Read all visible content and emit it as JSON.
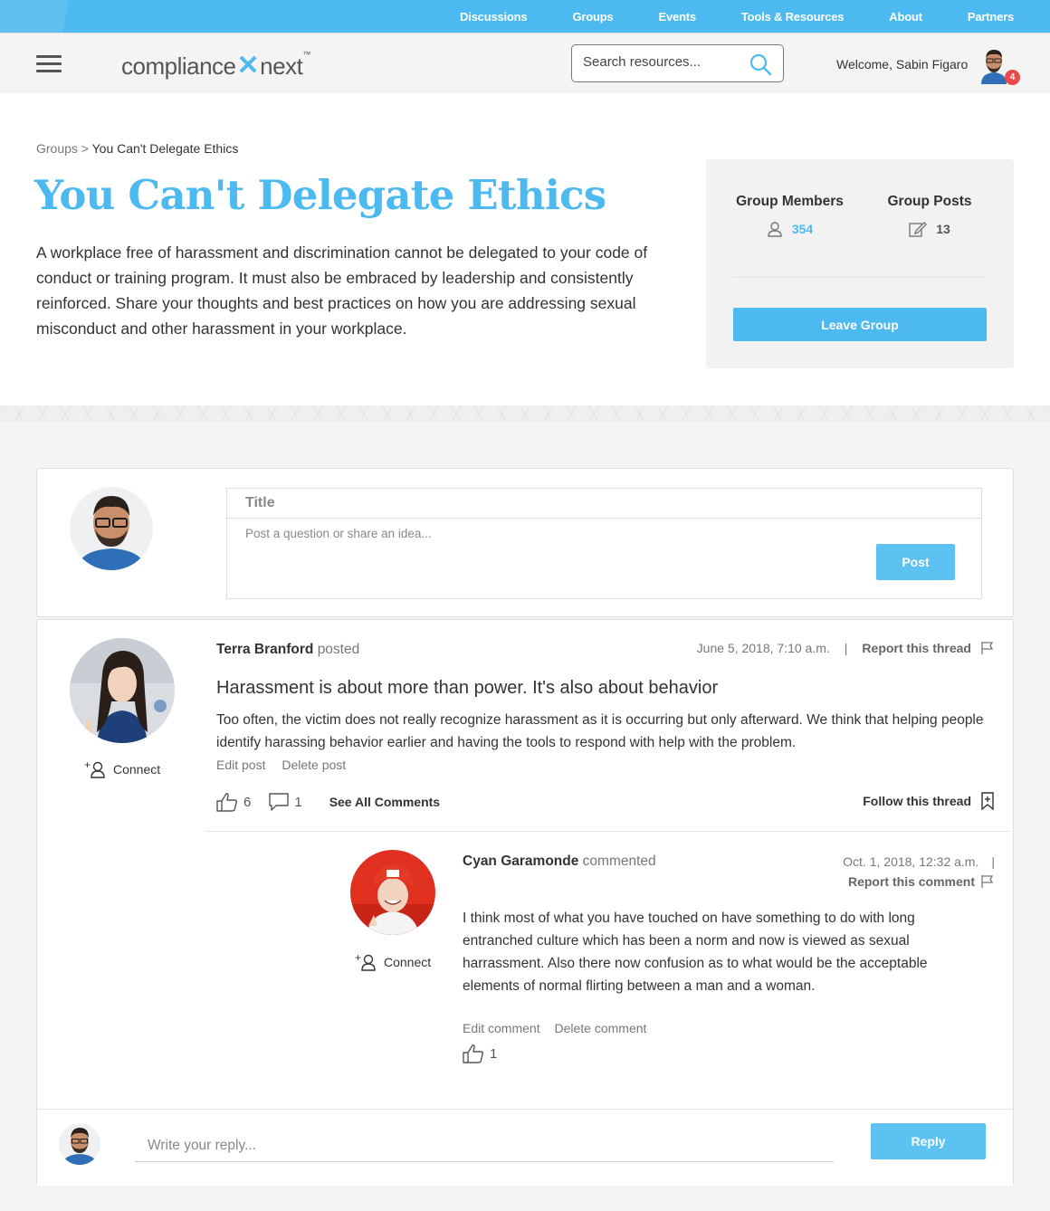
{
  "topnav": {
    "items": [
      "Discussions",
      "Groups",
      "Events",
      "Tools & Resources",
      "About",
      "Partners"
    ]
  },
  "header": {
    "logo_left": "compliance",
    "logo_x": "✕",
    "logo_right": "next",
    "logo_tm": "™",
    "search_placeholder": "Search resources...",
    "welcome": "Welcome, Sabin Figaro",
    "notification_count": "4"
  },
  "hero": {
    "breadcrumb_root": "Groups",
    "breadcrumb_sep": " > ",
    "breadcrumb_current": "You Can't Delegate Ethics",
    "title": "You Can't Delegate Ethics",
    "description": "A workplace free of harassment and discrimination cannot be delegated to your code of conduct or training program. It must also be embraced by leadership and consistently reinforced. Share your thoughts and best practices on how you are addressing sexual misconduct and other harassment in your workplace."
  },
  "group_card": {
    "members_label": "Group Members",
    "members_count": "354",
    "posts_label": "Group Posts",
    "posts_count": "13",
    "leave_label": "Leave Group"
  },
  "composer": {
    "title_placeholder": "Title",
    "body_placeholder": "Post a question or share an idea...",
    "post_label": "Post"
  },
  "thread": {
    "author": "Terra Branford",
    "action": "posted",
    "date": "June 5, 2018, 7:10 a.m.",
    "separator": "|",
    "report_label": "Report this thread",
    "title": "Harassment is about more than power. It's also about behavior",
    "body": "Too often, the victim does not really recognize harassment as it is occurring but only afterward. We think that helping people identify harassing behavior earlier and having the tools to respond with help with the problem.",
    "edit_label": "Edit post",
    "delete_label": "Delete post",
    "likes": "6",
    "comments": "1",
    "see_all_label": "See All Comments",
    "follow_label": "Follow this thread",
    "connect_label": "Connect"
  },
  "comment": {
    "author": "Cyan Garamonde",
    "action": "commented",
    "date": "Oct. 1, 2018, 12:32 a.m.",
    "separator": "|",
    "report_label": "Report this comment",
    "body": "I think most of what you have touched on have something to do with long entranched culture which has been a norm and now is viewed as sexual harrassment. Also there now confusion as to what would be the acceptable elements of normal flirting between a man and a woman.",
    "edit_label": "Edit comment",
    "delete_label": "Delete comment",
    "likes": "1",
    "connect_label": "Connect"
  },
  "reply": {
    "placeholder": "Write your reply...",
    "button_label": "Reply"
  },
  "colors": {
    "accent": "#4cbaf0",
    "badge": "#e94a4a"
  }
}
